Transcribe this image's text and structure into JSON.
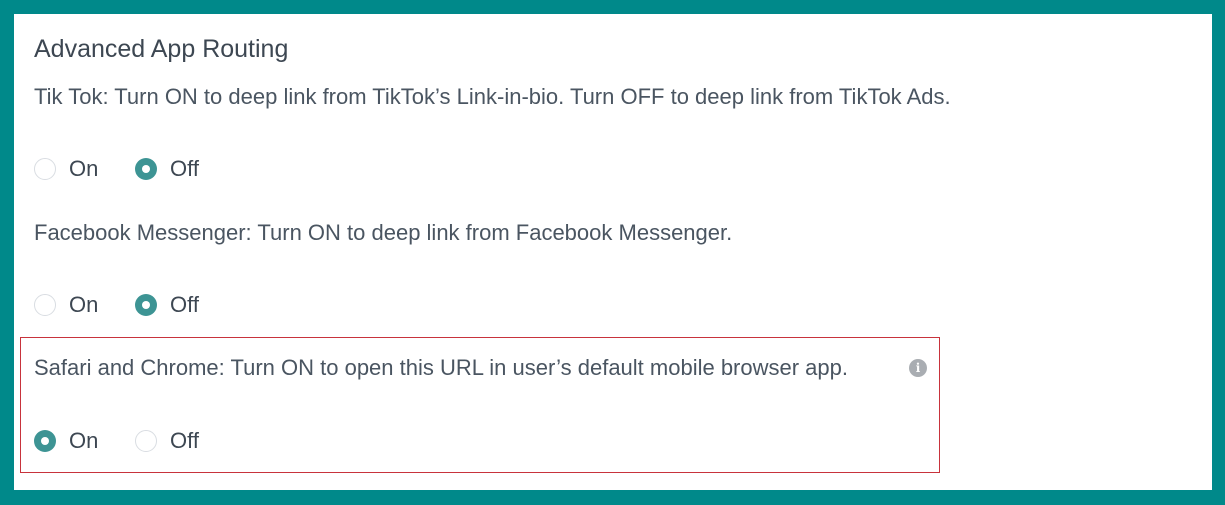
{
  "section": {
    "title": "Advanced App Routing"
  },
  "settings": [
    {
      "description": "Tik Tok: Turn ON to deep link from TikTok’s Link-in-bio. Turn OFF to deep link from TikTok Ads.",
      "options": [
        {
          "label": "On",
          "selected": false
        },
        {
          "label": "Off",
          "selected": true
        }
      ]
    },
    {
      "description": "Facebook Messenger: Turn ON to deep link from Facebook Messenger.",
      "options": [
        {
          "label": "On",
          "selected": false
        },
        {
          "label": "Off",
          "selected": true
        }
      ]
    },
    {
      "description": "Safari and Chrome: Turn ON to open this URL in user’s default mobile browser app.",
      "info_icon": "info-icon",
      "options": [
        {
          "label": "On",
          "selected": true
        },
        {
          "label": "Off",
          "selected": false
        }
      ]
    }
  ],
  "colors": {
    "frame": "#00898a",
    "radio_selected": "#3d9494",
    "highlight_border": "#c8333c",
    "text": "#3d4752"
  }
}
